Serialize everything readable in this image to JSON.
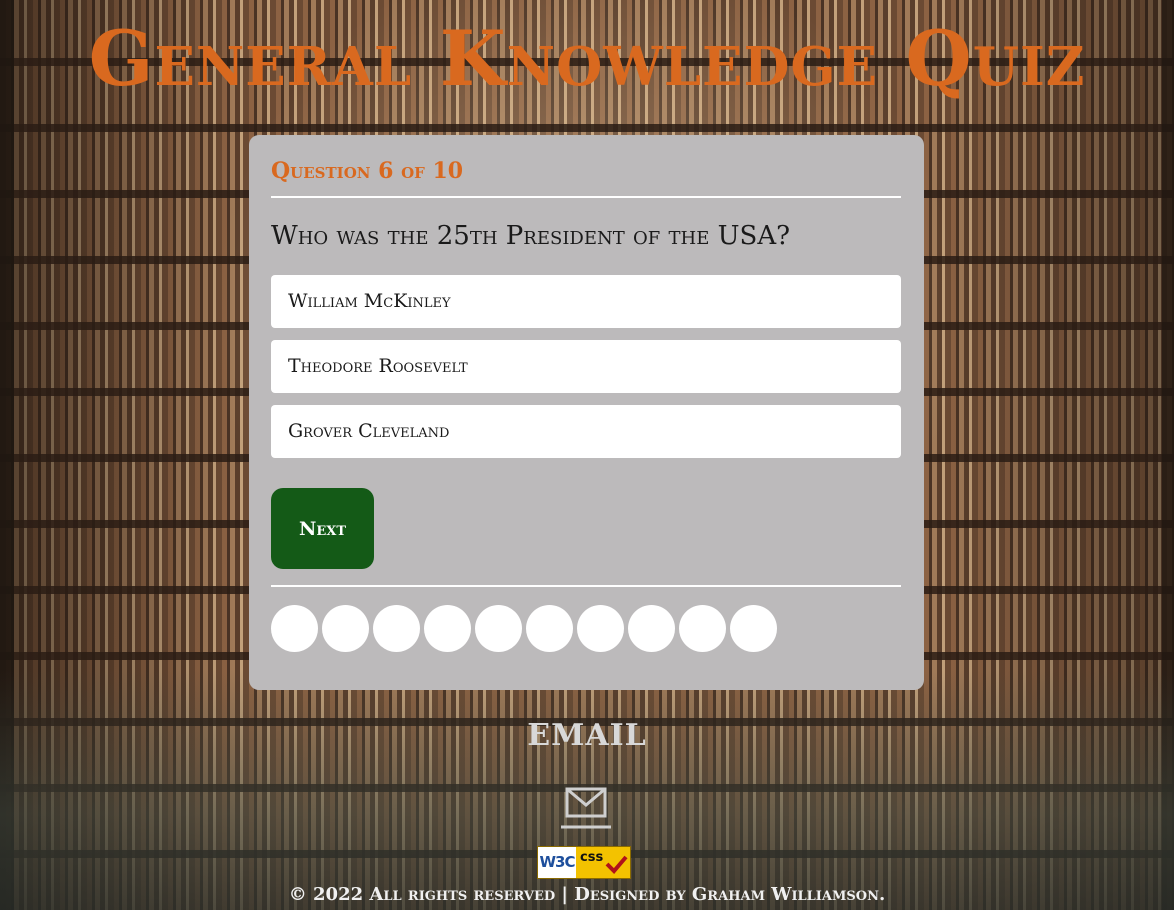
{
  "header": {
    "title": "General Knowledge Quiz"
  },
  "quiz": {
    "counter": "Question 6 of 10",
    "question": "Who was the 25th President of the USA?",
    "answers": [
      "William McKinley",
      "Theodore Roosevelt",
      "Grover Cleveland"
    ],
    "next_label": "Next",
    "progress_total": 10
  },
  "footer": {
    "email_label": "EMAIL",
    "badge_left": "W3C",
    "badge_right": "css",
    "copyright": "© 2022 All rights reserved | Designed by Graham Williamson."
  },
  "colors": {
    "accent_orange": "#d9691f",
    "card_bg": "#bcbabb",
    "next_button": "#145a17"
  }
}
